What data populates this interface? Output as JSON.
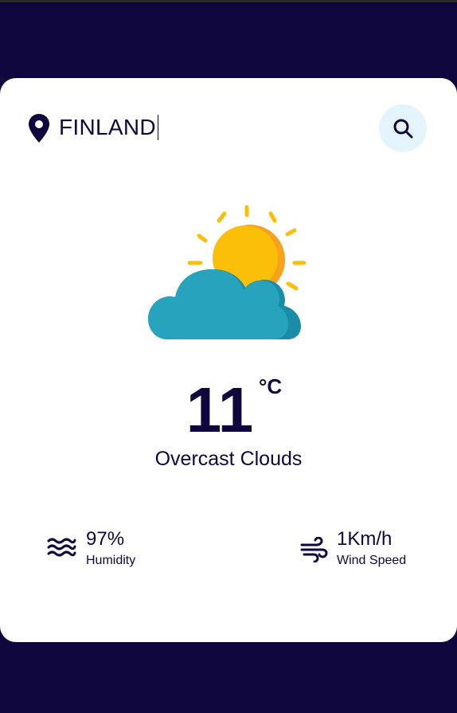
{
  "search": {
    "value": "FINLAND",
    "icon": "location-pin-icon",
    "button_icon": "search-icon"
  },
  "weather": {
    "icon": "partly-cloudy-icon",
    "temperature": "11",
    "unit": "°C",
    "description": "Overcast Clouds"
  },
  "stats": {
    "humidity": {
      "value": "97%",
      "label": "Humidity",
      "icon": "waves-icon"
    },
    "wind": {
      "value": "1Km/h",
      "label": "Wind Speed",
      "icon": "wind-icon"
    }
  },
  "colors": {
    "background": "#10063e",
    "card": "#ffffff",
    "text": "#10063e",
    "search_button_bg": "#e4f4fd",
    "sun": "#fbbf0a",
    "sun_shade": "#f6a21d",
    "cloud": "#27a3bd",
    "cloud_shade": "#1b8ca8"
  }
}
